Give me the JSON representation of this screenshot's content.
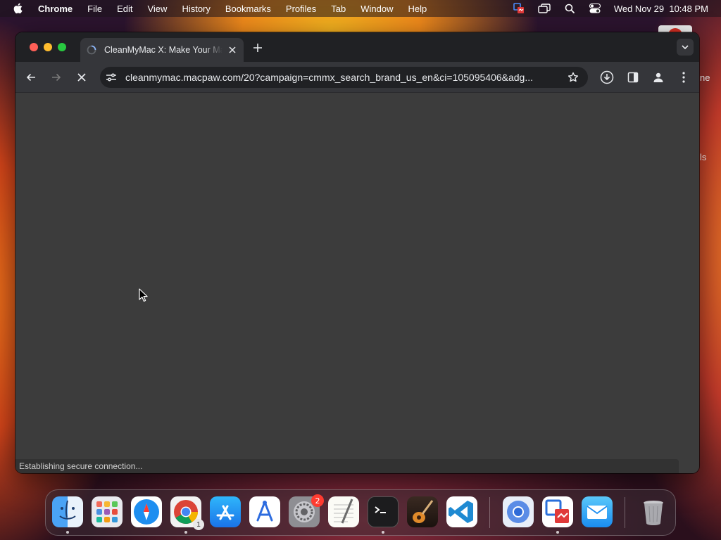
{
  "menubar": {
    "app_name": "Chrome",
    "items": [
      "File",
      "Edit",
      "View",
      "History",
      "Bookmarks",
      "Profiles",
      "Tab",
      "Window",
      "Help"
    ],
    "clock": "Wed Nov 29  10:48 PM"
  },
  "browser": {
    "tab_title": "CleanMyMac X: Make Your Mac",
    "url": "cleanmymac.macpaw.com/20?campaign=cmmx_search_brand_us_en&ci=105095406&adg...",
    "status": "Establishing secure connection...",
    "loading": true
  },
  "background_peek": {
    "text_1": "ne",
    "text_2": "ls"
  },
  "dock": {
    "items": [
      {
        "name": "finder",
        "running": true
      },
      {
        "name": "launchpad",
        "running": false
      },
      {
        "name": "safari",
        "running": false
      },
      {
        "name": "chrome",
        "running": true,
        "sub_badge": "1"
      },
      {
        "name": "app-store",
        "running": false
      },
      {
        "name": "instruments",
        "running": false
      },
      {
        "name": "system-settings",
        "running": false,
        "badge": "2"
      },
      {
        "name": "textedit",
        "running": false
      },
      {
        "name": "terminal",
        "running": true
      },
      {
        "name": "garageband",
        "running": false
      },
      {
        "name": "vscode",
        "running": false
      },
      {
        "name": "chromium",
        "running": false
      },
      {
        "name": "remote-desktop",
        "running": true
      },
      {
        "name": "mail",
        "running": false
      },
      {
        "name": "trash",
        "running": false
      }
    ]
  }
}
